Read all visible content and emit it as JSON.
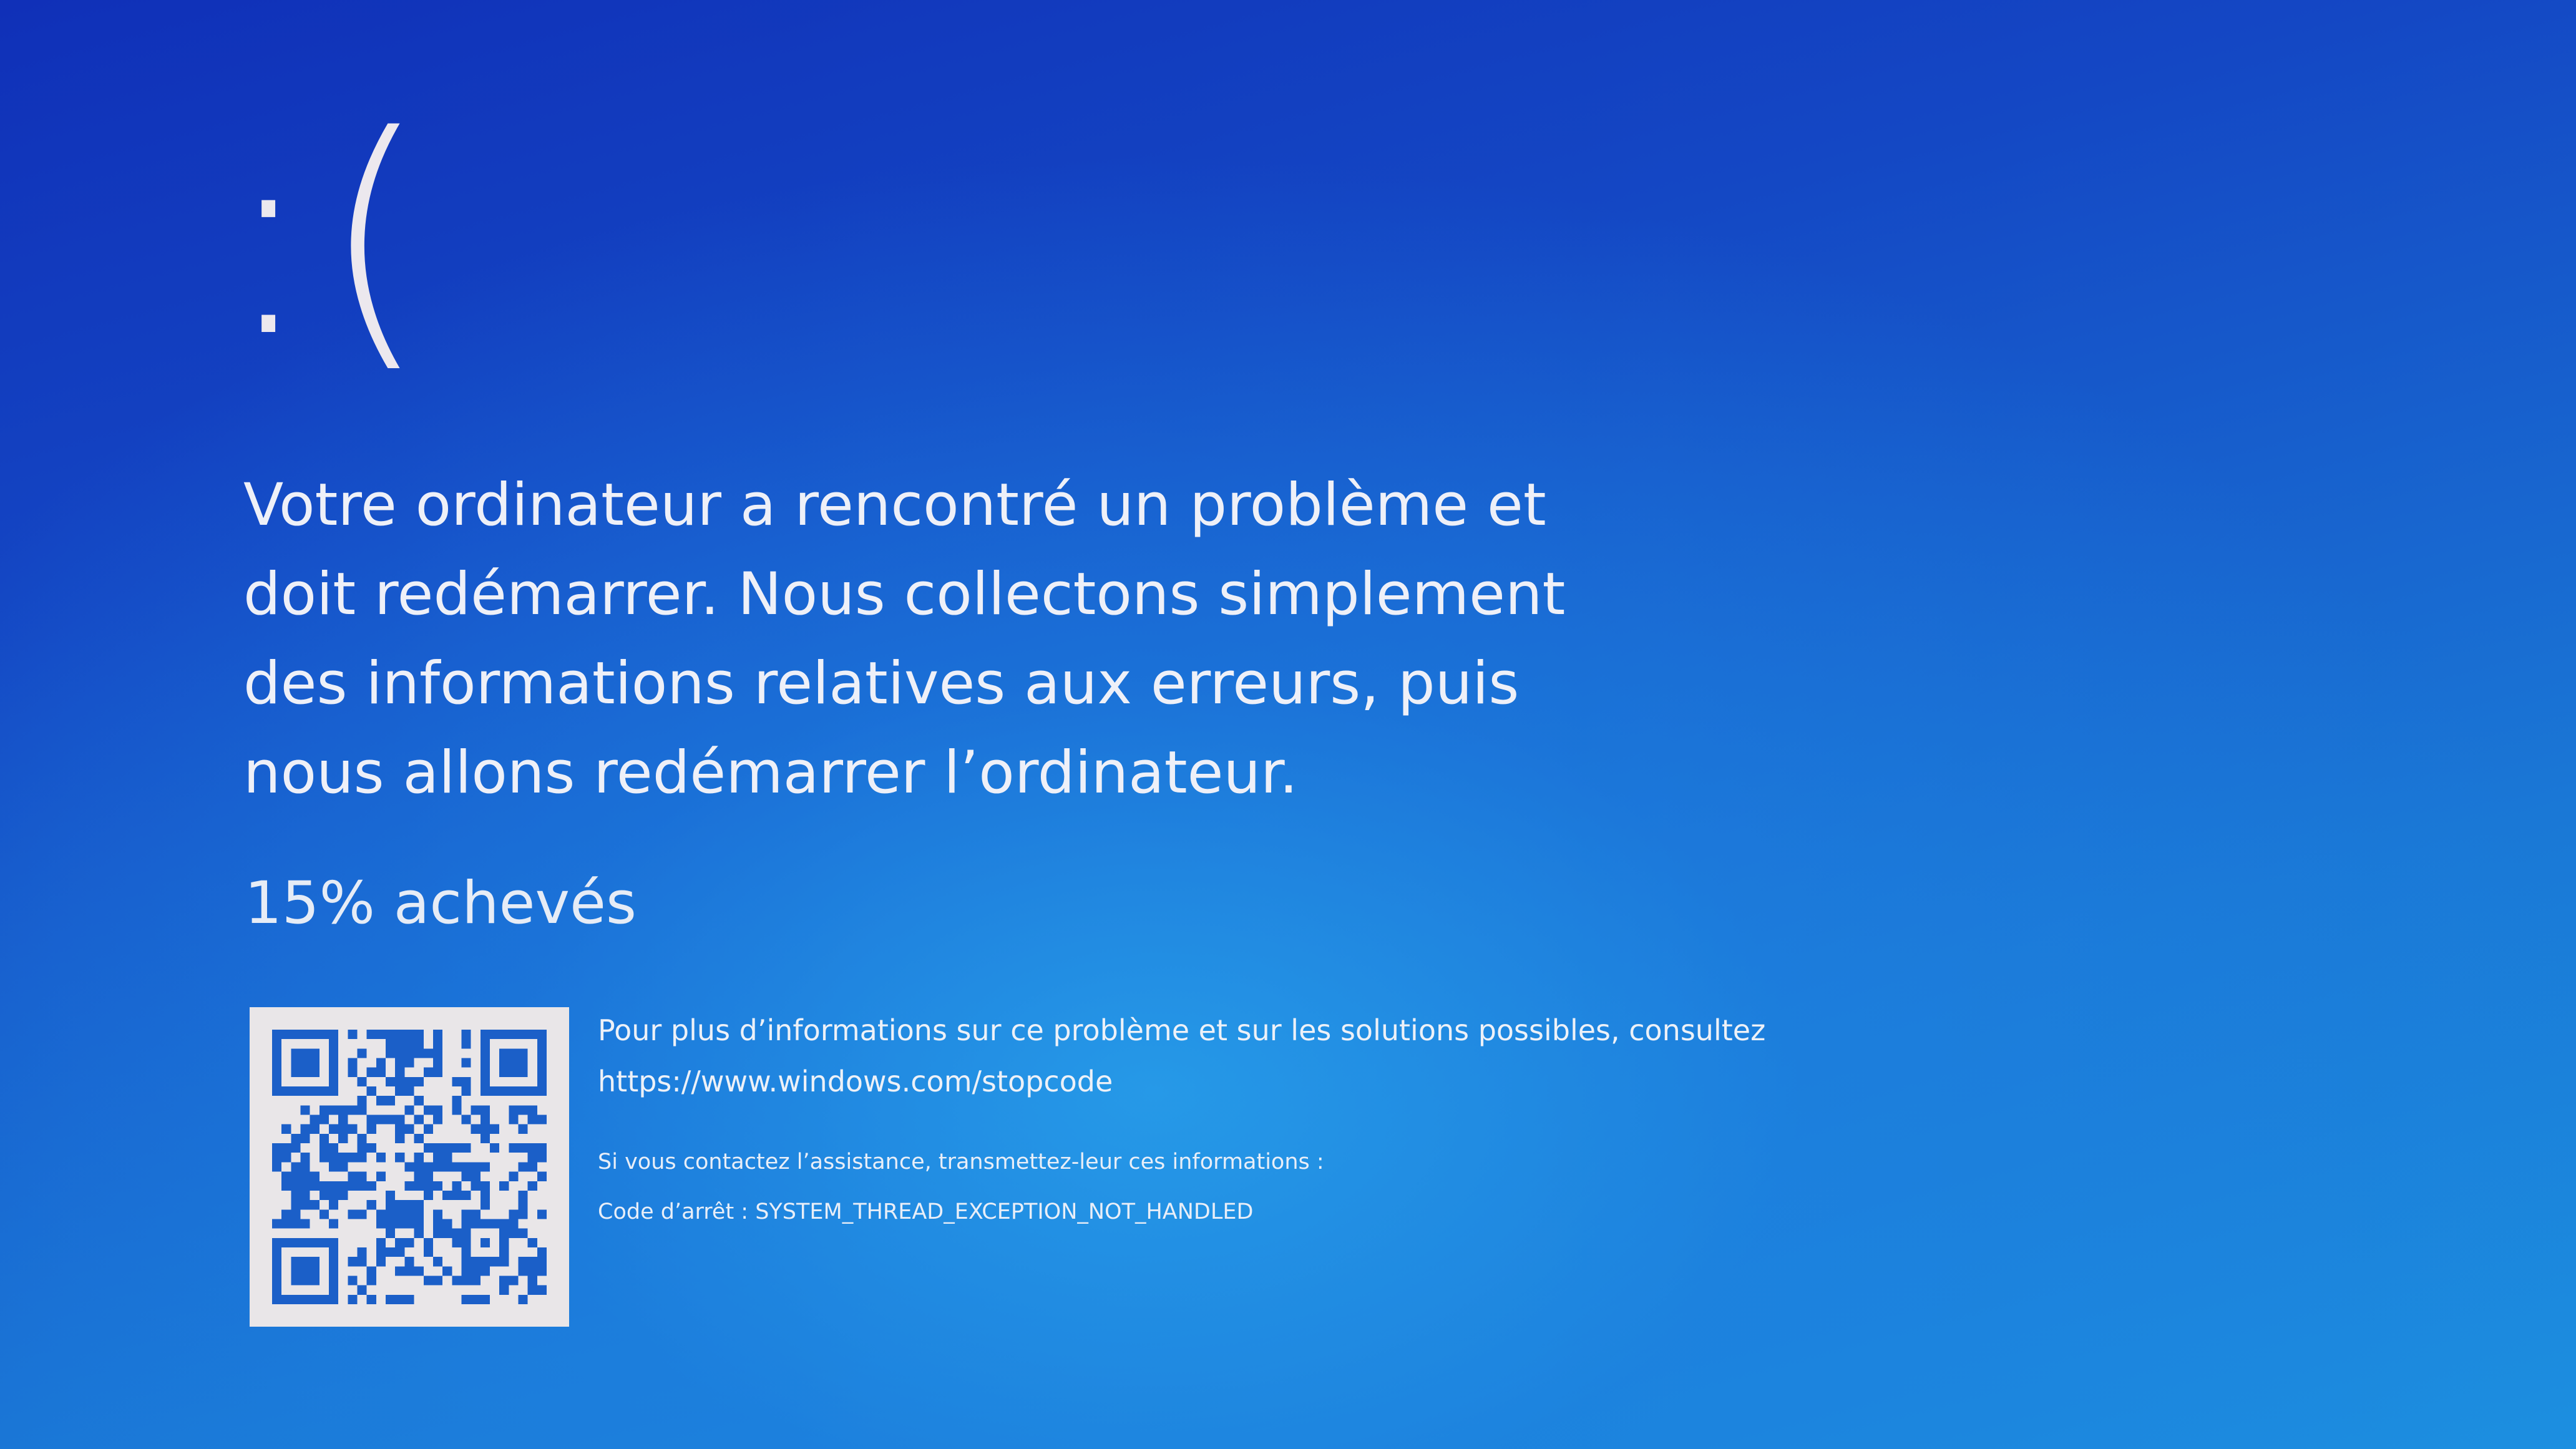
{
  "screen": {
    "sad_face": ":(",
    "message": "Votre ordinateur a rencontré un problème et doit redémarrer. Nous collectons simplement des informations relatives aux erreurs, puis nous allons redémarrer l’ordinateur.",
    "progress_text": "15% achevés",
    "progress_percent": 15,
    "more_info": "Pour plus d’informations sur ce problème et sur les solutions possibles, consultez",
    "stopcode_url": "https://www.windows.com/stopcode",
    "support_note": "Si vous contactez l’assistance, transmettez-leur ces informations :",
    "stop_code": "Code d’arrêt : SYSTEM_THREAD_EXCEPTION_NOT_HANDLED"
  },
  "colors": {
    "background_top": "#1030b8",
    "background_bottom": "#1c8fe0",
    "text": "#eef0f8",
    "qr_module": "#1b5fc8",
    "qr_background": "#e9e6e8"
  }
}
